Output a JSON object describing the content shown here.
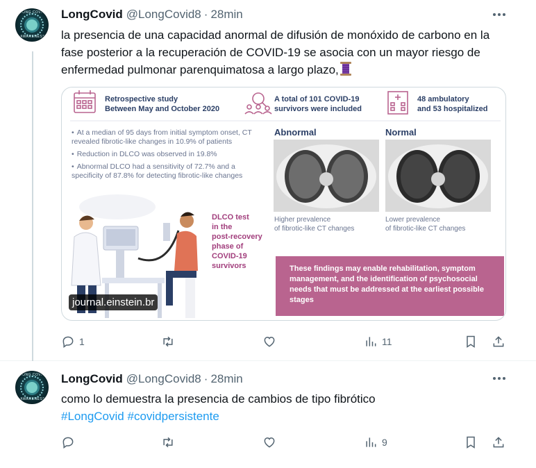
{
  "tweets": [
    {
      "name": "LongCovid",
      "handle": "@LongCovid8",
      "separator": "·",
      "time": "28min",
      "text": "la presencia de una capacidad anormal de difusión de monóxido de carbono en la fase posterior a la recuperación de COVID-19 se asocia con un mayor riesgo de enfermedad pulmonar parenquimatosa a largo plazo,",
      "text_emoji": "spool-of-thread-emoji",
      "media": {
        "watermark": "journal.einstein.br",
        "infographic": {
          "study": "Retrospective study\nBetween May and October 2020",
          "survivors": "A total of 101 COVID-19\nsurvivors were included",
          "patients": "48 ambulatory\nand 53 hospitalized",
          "findings": [
            "At a median of 95 days from initial symptom onset, CT revealed fibrotic-like changes in 10.9% of patients",
            "Reduction in DLCO was observed in 19.8%",
            "Abnormal DLCO had a sensitivity of 72.7% and a specificity of 87.8% for detecting fibrotic-like changes"
          ],
          "abnormal_label": "Abnormal",
          "normal_label": "Normal",
          "abnormal_caption": "Higher prevalence\nof fibrotic-like CT changes",
          "normal_caption": "Lower prevalence\nof fibrotic-like CT changes",
          "dlco": "DLCO test\nin the\npost-recovery\nphase of\nCOVID-19\nsurvivors",
          "conclusion": "These findings may enable rehabilitation, symptom management, and the identification of psychosocial needs that must be addressed at the earliest possible stages"
        }
      },
      "actions": {
        "replies": "1",
        "retweets": "",
        "likes": "",
        "views": "11"
      }
    },
    {
      "name": "LongCovid",
      "handle": "@LongCovid8",
      "separator": "·",
      "time": "28min",
      "text": "como lo demuestra la presencia de cambios de tipo fibrótico",
      "hashtags": [
        "#LongCovid",
        "#covidpersistente"
      ],
      "actions": {
        "replies": "",
        "retweets": "",
        "likes": "",
        "views": "9"
      }
    }
  ],
  "icons": {
    "reply": "reply-icon",
    "retweet": "retweet-icon",
    "like": "heart-icon",
    "views": "views-chart-icon",
    "bookmark": "bookmark-icon",
    "share": "share-icon",
    "more": "more-dots-icon"
  },
  "colors": {
    "text": "#0f1419",
    "secondary": "#536471",
    "link": "#1d9bf0",
    "thread": "#cfd9de",
    "accent_pink": "#b9648f"
  }
}
